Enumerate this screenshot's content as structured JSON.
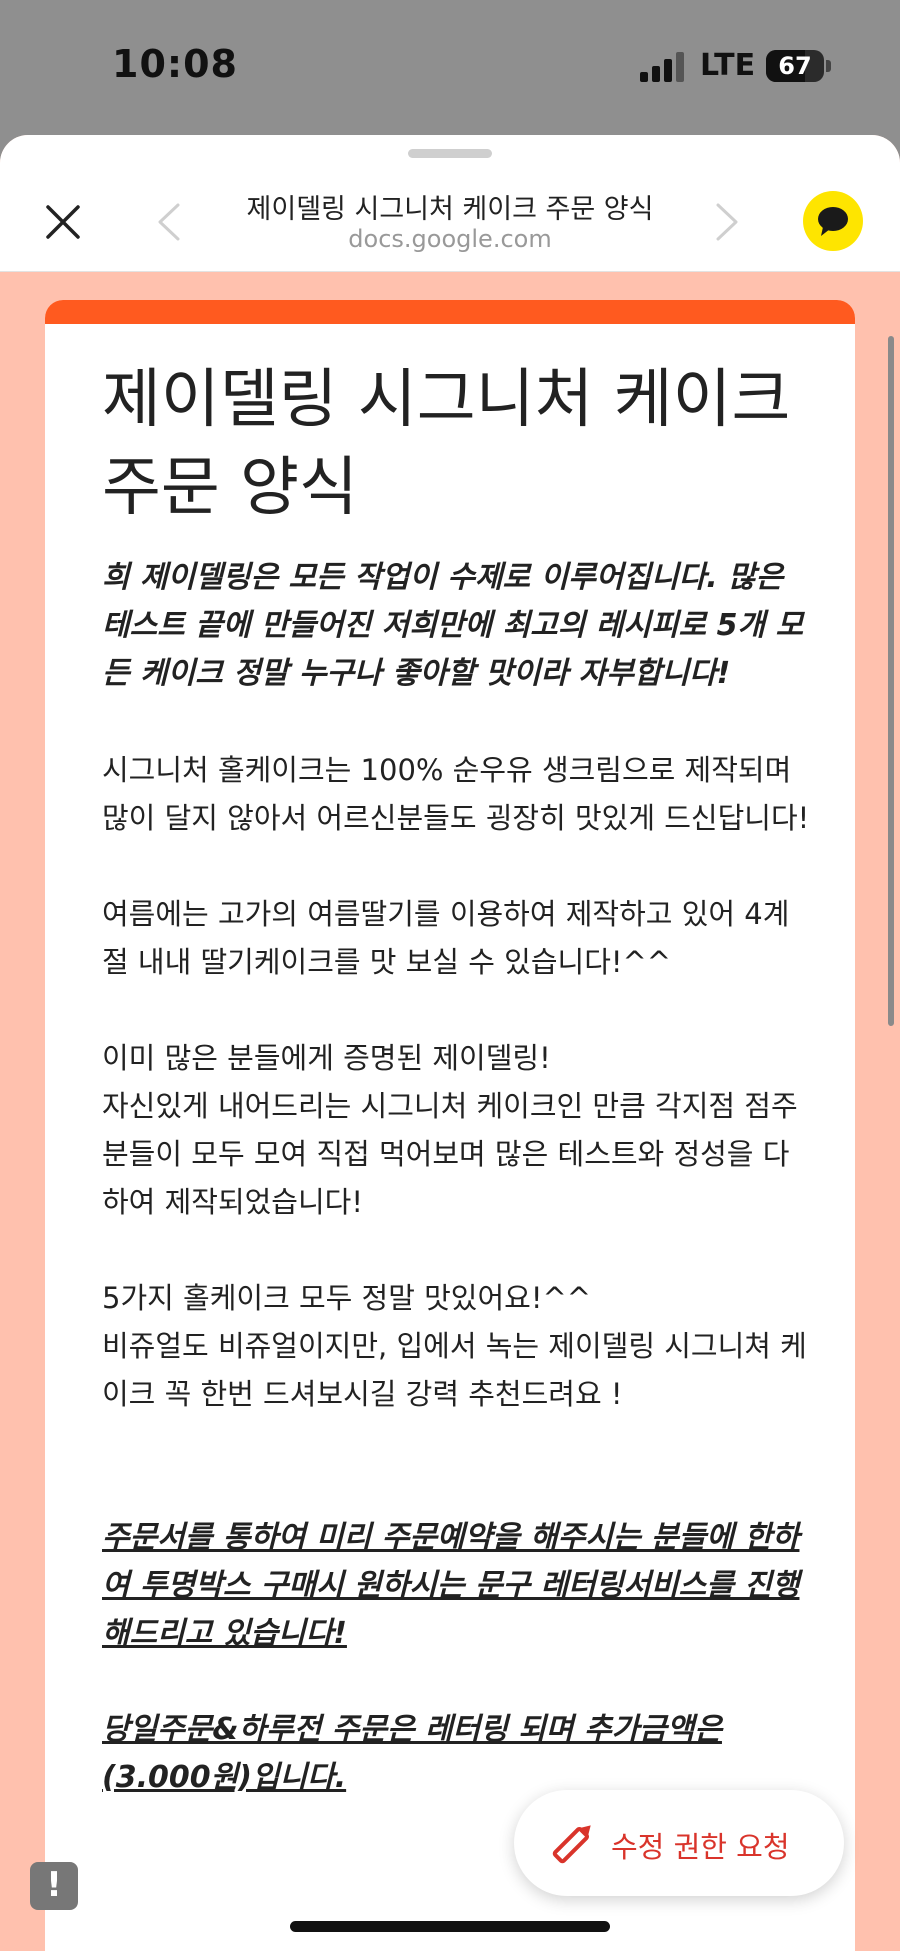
{
  "status_bar": {
    "time": "10:08",
    "network": "LTE",
    "battery": "67"
  },
  "header": {
    "title": "제이델링 시그니처 케이크 주문 양식",
    "url": "docs.google.com",
    "icons": {
      "close": "close-icon",
      "back": "chevron-left-icon",
      "forward": "chevron-right-icon",
      "kakao": "kakao-talk-icon"
    }
  },
  "document": {
    "title": "제이델링 시그니처 케이크 주문 양식",
    "intro": "희 제이델링은 모든 작업이 수제로 이루어집니다. 많은 테스트 끝에 만들어진 저희만에 최고의 레시피로 5개 모든 케이크 정말 누구나 좋아할 맛이라 자부합니다!",
    "para1": "시그니처 홀케이크는 100% 순우유 생크림으로 제작되며 많이 달지 않아서 어르신분들도 굉장히 맛있게 드신답니다!",
    "para2": "여름에는 고가의 여름딸기를 이용하여 제작하고 있어 4계절 내내 딸기케이크를 맛 보실 수 있습니다!^^",
    "para3_line1": "이미 많은 분들에게 증명된 제이델링!",
    "para3_line2": "자신있게 내어드리는 시그니처 케이크인 만큼 각지점 점주분들이 모두 모여 직접 먹어보며 많은 테스트와 정성을 다하여 제작되었습니다!",
    "para4_line1": "5가지 홀케이크 모두 정말 맛있어요!^^",
    "para4_line2": "비쥬얼도 비쥬얼이지만, 입에서 녹는 제이델링 시그니쳐 케이크 꼭 한번 드셔보시길 강력 추천드려요 !",
    "notice1": "주문서를 통하여 미리 주문예약을 해주시는 분들에 한하여 투명박스 구매시 원하시는 문구 레터링서비스를 진행해드리고 있습니다!",
    "notice2": "당일주문&하루전 주문은 레터링 되며 추가금액은 (3.000원)입니다."
  },
  "actions": {
    "edit_request_label": "수정 권한 요청",
    "edit_icon": "pencil-icon",
    "report_icon": "report-icon",
    "report_glyph": "!"
  },
  "colors": {
    "accent": "#ff5a1f",
    "sheet_bg": "#ffc1ae",
    "edit_label": "#d9342b",
    "kakao_yellow": "#fee500"
  }
}
